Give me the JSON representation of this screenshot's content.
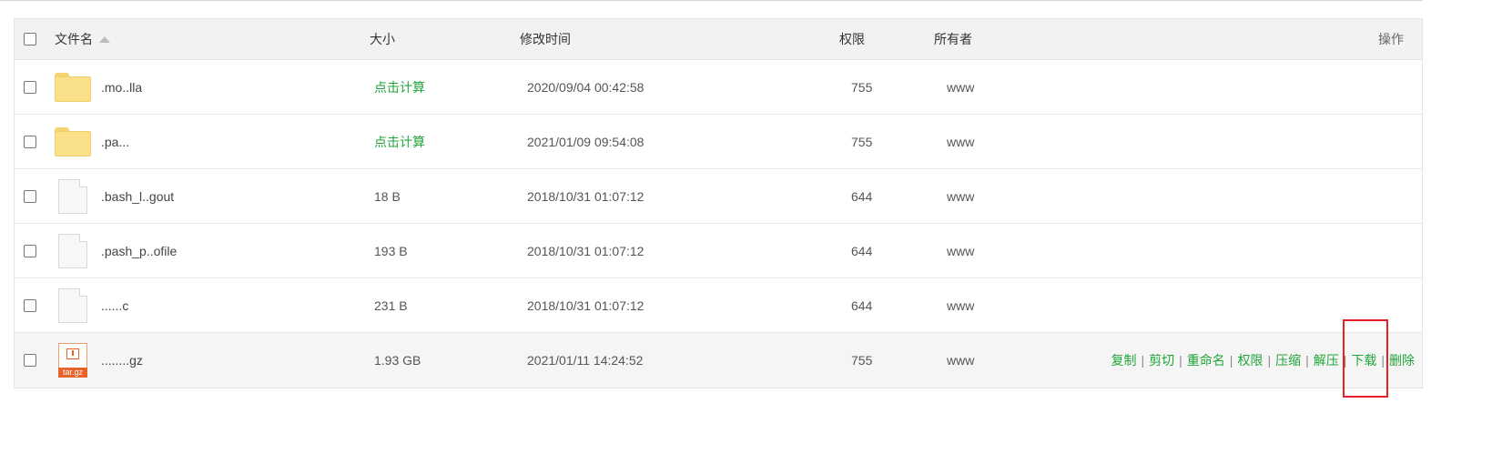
{
  "header": {
    "name": "文件名",
    "size": "大小",
    "modified": "修改时间",
    "permission": "权限",
    "owner": "所有者",
    "operations": "操作"
  },
  "rows": [
    {
      "name": ".mo..lla",
      "type": "folder",
      "size": "点击计算",
      "size_is_link": true,
      "modified": "2020/09/04 00:42:58",
      "perm": "755",
      "owner": "www"
    },
    {
      "name": ".pa...",
      "type": "folder",
      "size": "点击计算",
      "size_is_link": true,
      "modified": "2021/01/09 09:54:08",
      "perm": "755",
      "owner": "www"
    },
    {
      "name": ".bash_l..gout",
      "type": "file",
      "size": "18 B",
      "size_is_link": false,
      "modified": "2018/10/31 01:07:12",
      "perm": "644",
      "owner": "www"
    },
    {
      "name": ".pash_p..ofile",
      "type": "file",
      "size": "193 B",
      "size_is_link": false,
      "modified": "2018/10/31 01:07:12",
      "perm": "644",
      "owner": "www"
    },
    {
      "name": "......c",
      "type": "file",
      "size": "231 B",
      "size_is_link": false,
      "modified": "2018/10/31 01:07:12",
      "perm": "644",
      "owner": "www"
    },
    {
      "name": "........gz",
      "type": "archive",
      "icon_label": "tar.gz",
      "size": "1.93 GB",
      "size_is_link": false,
      "modified": "2021/01/11 14:24:52",
      "perm": "755",
      "owner": "www"
    }
  ],
  "actions": [
    "复制",
    "剪切",
    "重命名",
    "权限",
    "压缩",
    "解压",
    "下载",
    "删除"
  ],
  "icons": {
    "folder": "folder-icon",
    "file": "file-icon",
    "archive": "archive-icon",
    "sort": "sort-asc-icon"
  },
  "colors": {
    "link_green": "#20a53a",
    "highlight_box": "#e8202a",
    "archive_orange": "#e8632a"
  }
}
